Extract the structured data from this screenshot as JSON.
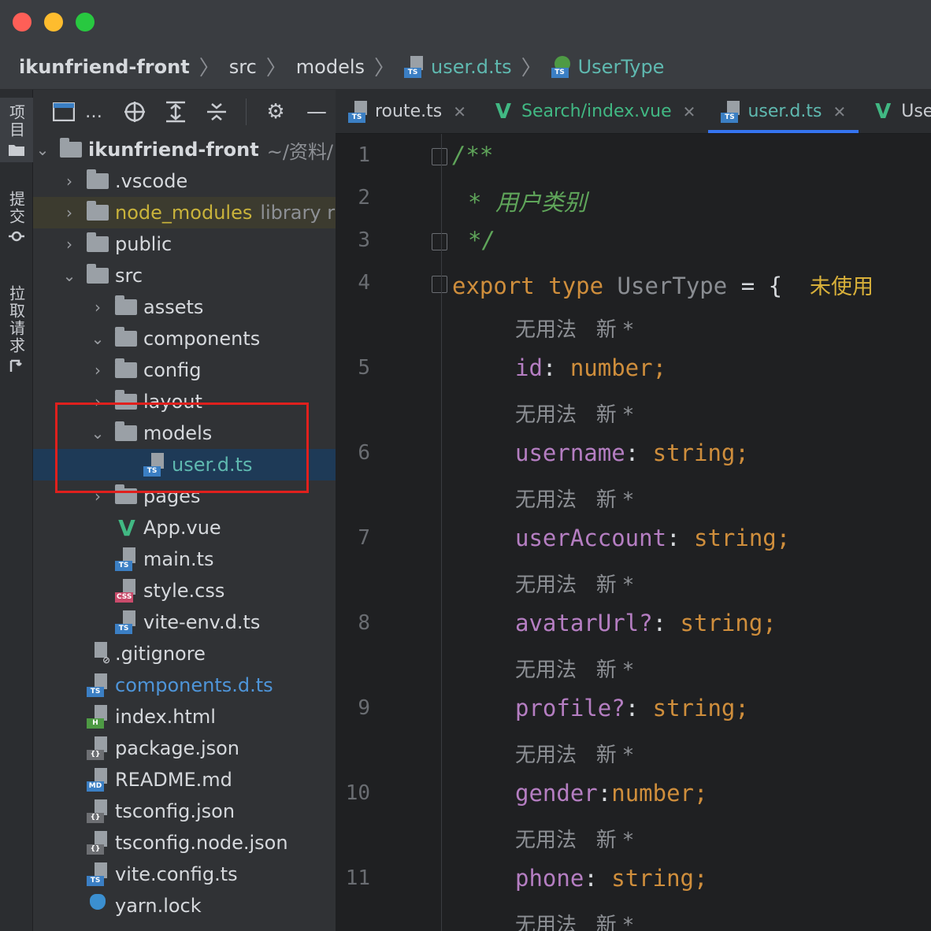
{
  "breadcrumb": {
    "project": "ikunfriend-front",
    "dir1": "src",
    "dir2": "models",
    "file": "user.d.ts",
    "symbol": "UserType"
  },
  "side_tabs": {
    "project": "项目",
    "commit": "提交",
    "pull_requests": "拉取请求"
  },
  "tree": {
    "root_name": "ikunfriend-front",
    "root_path": "~/资料/",
    "items": [
      {
        "label": "ikunfriend-front",
        "hint": "~/资料/",
        "kind": "folder",
        "chev": "⌄"
      },
      {
        "label": ".vscode",
        "kind": "folder",
        "chev": "›"
      },
      {
        "label": "node_modules",
        "hint": "library r",
        "kind": "folder",
        "chev": "›"
      },
      {
        "label": "public",
        "kind": "folder",
        "chev": "›"
      },
      {
        "label": "src",
        "kind": "folder",
        "chev": "⌄"
      },
      {
        "label": "assets",
        "kind": "folder",
        "chev": "›"
      },
      {
        "label": "components",
        "kind": "folder",
        "chev": "⌄"
      },
      {
        "label": "config",
        "kind": "folder",
        "chev": "›"
      },
      {
        "label": "layout",
        "kind": "folder",
        "chev": "›"
      },
      {
        "label": "models",
        "kind": "folder",
        "chev": "⌄"
      },
      {
        "label": "user.d.ts",
        "kind": "ts"
      },
      {
        "label": "pages",
        "kind": "folder",
        "chev": "›"
      },
      {
        "label": "App.vue",
        "kind": "vue"
      },
      {
        "label": "main.ts",
        "kind": "ts"
      },
      {
        "label": "style.css",
        "kind": "css"
      },
      {
        "label": "vite-env.d.ts",
        "kind": "ts"
      },
      {
        "label": ".gitignore",
        "kind": "ignore"
      },
      {
        "label": "components.d.ts",
        "kind": "ts"
      },
      {
        "label": "index.html",
        "kind": "html"
      },
      {
        "label": "package.json",
        "kind": "json"
      },
      {
        "label": "README.md",
        "kind": "md"
      },
      {
        "label": "tsconfig.json",
        "kind": "json"
      },
      {
        "label": "tsconfig.node.json",
        "kind": "json"
      },
      {
        "label": "vite.config.ts",
        "kind": "ts"
      },
      {
        "label": "yarn.lock",
        "kind": "yarn"
      }
    ]
  },
  "editor_tabs": [
    {
      "label": "route.ts",
      "kind": "ts",
      "close": "✕"
    },
    {
      "label": "Search/index.vue",
      "kind": "vue",
      "close": "✕"
    },
    {
      "label": "user.d.ts",
      "kind": "ts",
      "close": "✕",
      "active": true
    },
    {
      "label": "User",
      "kind": "vue"
    }
  ],
  "icons": {
    "ts_badge": "TS",
    "css_badge": "CSS",
    "html_badge": "H",
    "md_badge": "MD",
    "json_badge": "{}",
    "vue_glyph": "V"
  },
  "line_numbers": [
    "1",
    "2",
    "3",
    "4",
    "5",
    "6",
    "7",
    "8",
    "9",
    "10",
    "11"
  ],
  "code": {
    "l1": "/**",
    "l2_star": "* ",
    "l2_text": "用户类别",
    "l3": "*/",
    "l4_kw1": "export",
    "l4_kw2": "type",
    "l4_name": "UserType",
    "l4_op": "= {",
    "l4_hint": "未使用",
    "author": "无用法   新 *",
    "fields": [
      {
        "name": "id",
        "sep": ": ",
        "type": "number;"
      },
      {
        "name": "username",
        "sep": ": ",
        "type": "string;"
      },
      {
        "name": "userAccount",
        "sep": ": ",
        "type": "string;"
      },
      {
        "name": "avatarUrl?",
        "sep": ": ",
        "type": "string;"
      },
      {
        "name": "profile?",
        "sep": ": ",
        "type": "string;"
      },
      {
        "name": "gender",
        "sep": ":",
        "type": "number;"
      },
      {
        "name": "phone",
        "sep": ": ",
        "type": "string;"
      }
    ]
  },
  "colors": {
    "selection": "#1e3a57",
    "highlight_box": "#e0201d",
    "comment": "#5fa55a",
    "keyword": "#cf8e3c",
    "property": "#b57ec2"
  }
}
